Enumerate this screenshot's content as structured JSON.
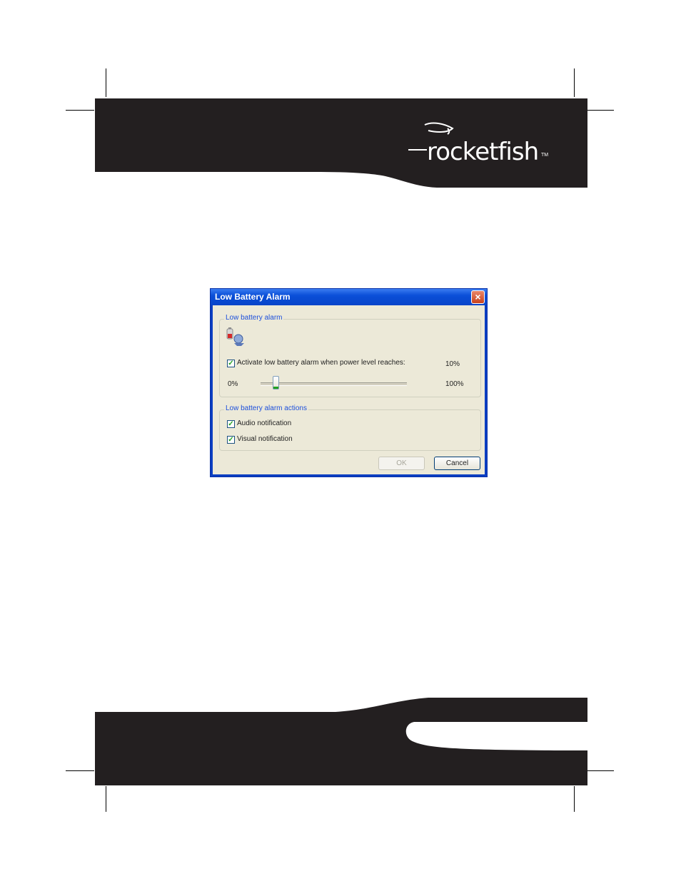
{
  "brand": {
    "name": "rocketfish",
    "tm": "TM"
  },
  "dialog": {
    "title": "Low Battery Alarm",
    "close_icon": "close-icon",
    "group_alarm": {
      "label": "Low battery alarm",
      "icon": "battery-alarm-icon",
      "activate_label": "Activate low battery alarm when power level reaches:",
      "activate_checked": true,
      "level_value": "10%",
      "slider_min_label": "0%",
      "slider_max_label": "100%",
      "slider_level": 0.1
    },
    "group_actions": {
      "label": "Low battery alarm actions",
      "audio_label": "Audio notification",
      "audio_checked": true,
      "visual_label": "Visual notification",
      "visual_checked": true
    },
    "ok_label": "OK",
    "ok_enabled": false,
    "cancel_label": "Cancel"
  },
  "colors": {
    "band": "#231f20",
    "titlebar": "#0a4fd8",
    "dialog_bg": "#ece9d8",
    "group_label": "#1c4fdc"
  }
}
